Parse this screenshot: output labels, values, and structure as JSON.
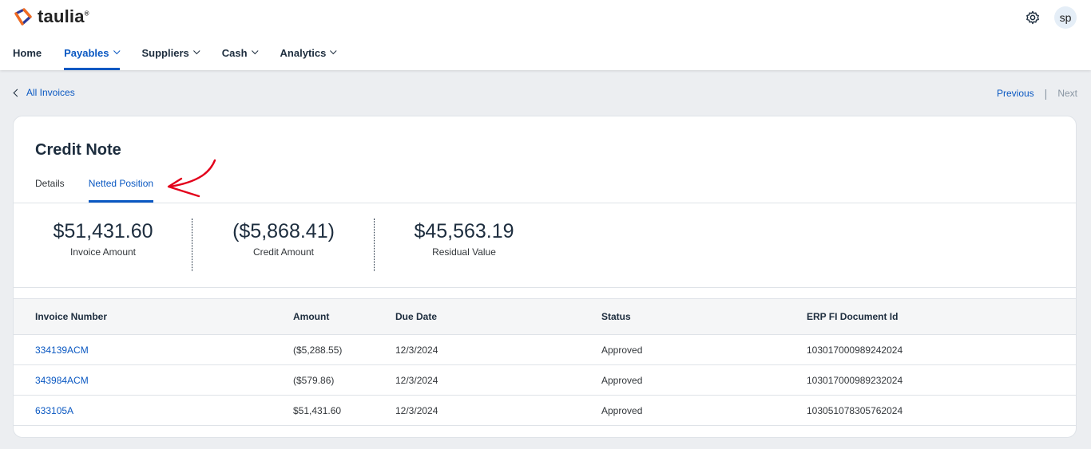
{
  "brand": {
    "name": "taulia",
    "trademark": "®",
    "accent": "#0a58c2",
    "logo_colors": [
      "#f26b21",
      "#2b3a9a"
    ]
  },
  "user": {
    "initials": "sp"
  },
  "nav": [
    {
      "label": "Home",
      "has_menu": false,
      "active": false
    },
    {
      "label": "Payables",
      "has_menu": true,
      "active": true
    },
    {
      "label": "Suppliers",
      "has_menu": true,
      "active": false
    },
    {
      "label": "Cash",
      "has_menu": true,
      "active": false
    },
    {
      "label": "Analytics",
      "has_menu": true,
      "active": false
    }
  ],
  "back_link": "All Invoices",
  "pager": {
    "previous": "Previous",
    "separator": "|",
    "next": "Next"
  },
  "card": {
    "title": "Credit Note",
    "tabs": [
      {
        "label": "Details",
        "active": false
      },
      {
        "label": "Netted Position",
        "active": true
      }
    ],
    "annotation": {
      "icon": "red-arrow-icon",
      "color": "#e3001b"
    },
    "summary": [
      {
        "value": "$51,431.60",
        "label": "Invoice Amount"
      },
      {
        "value": "($5,868.41)",
        "label": "Credit Amount"
      },
      {
        "value": "$45,563.19",
        "label": "Residual Value"
      }
    ],
    "table": {
      "headers": [
        "Invoice Number",
        "Amount",
        "Due Date",
        "Status",
        "ERP FI Document Id"
      ],
      "rows": [
        [
          "334139ACM",
          "($5,288.55)",
          "12/3/2024",
          "Approved",
          "103017000989242024"
        ],
        [
          "343984ACM",
          "($579.86)",
          "12/3/2024",
          "Approved",
          "103017000989232024"
        ],
        [
          "633105A",
          "$51,431.60",
          "12/3/2024",
          "Approved",
          "103051078305762024"
        ]
      ]
    }
  }
}
